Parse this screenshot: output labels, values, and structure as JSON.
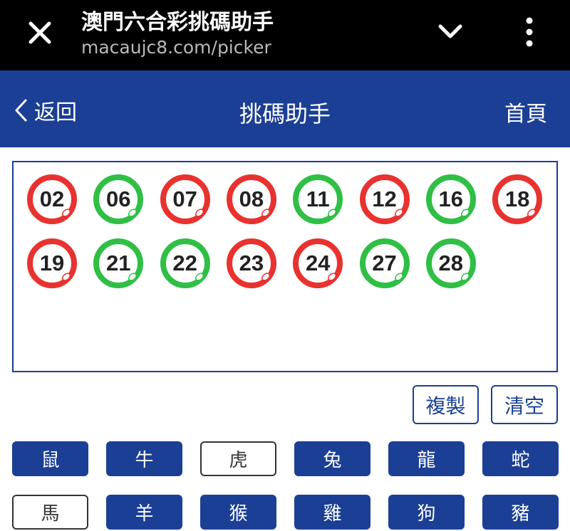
{
  "browser": {
    "title": "澳門六合彩挑碼助手",
    "url": "macaujc8.com/picker"
  },
  "header": {
    "back_label": "返回",
    "title": "挑碼助手",
    "home_label": "首頁"
  },
  "colors": {
    "brand_blue": "#1b3f94",
    "ball_red": "#e8322f",
    "ball_green": "#2fbf45"
  },
  "balls": [
    {
      "number": "02",
      "color": "red"
    },
    {
      "number": "06",
      "color": "green"
    },
    {
      "number": "07",
      "color": "red"
    },
    {
      "number": "08",
      "color": "red"
    },
    {
      "number": "11",
      "color": "green"
    },
    {
      "number": "12",
      "color": "red"
    },
    {
      "number": "16",
      "color": "green"
    },
    {
      "number": "18",
      "color": "red"
    },
    {
      "number": "19",
      "color": "red"
    },
    {
      "number": "21",
      "color": "green"
    },
    {
      "number": "22",
      "color": "green"
    },
    {
      "number": "23",
      "color": "red"
    },
    {
      "number": "24",
      "color": "red"
    },
    {
      "number": "27",
      "color": "green"
    },
    {
      "number": "28",
      "color": "green"
    }
  ],
  "actions": {
    "copy_label": "複製",
    "clear_label": "清空"
  },
  "zodiac": [
    {
      "label": "鼠",
      "selected": true
    },
    {
      "label": "牛",
      "selected": true
    },
    {
      "label": "虎",
      "selected": false
    },
    {
      "label": "兔",
      "selected": true
    },
    {
      "label": "龍",
      "selected": true
    },
    {
      "label": "蛇",
      "selected": true
    },
    {
      "label": "馬",
      "selected": false
    },
    {
      "label": "羊",
      "selected": true
    },
    {
      "label": "猴",
      "selected": true
    },
    {
      "label": "雞",
      "selected": true
    },
    {
      "label": "狗",
      "selected": true
    },
    {
      "label": "豬",
      "selected": true
    }
  ]
}
